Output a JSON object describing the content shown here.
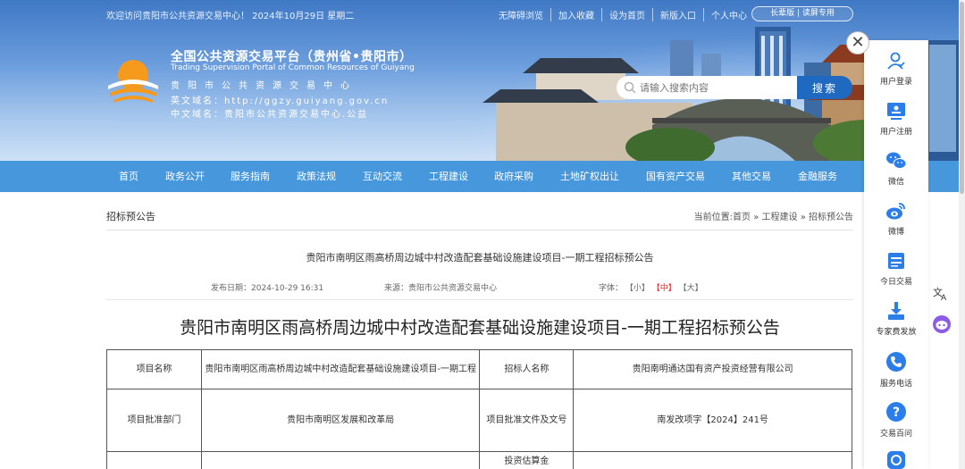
{
  "topbar": {
    "welcome": "欢迎访问贵阳市公共资源交易中心！  2024年10月29日 星期二",
    "links": [
      "无障碍浏览",
      "加入收藏",
      "设为首页",
      "新版入口",
      "个人中心"
    ],
    "pill": "长辈版  | 读屏专用"
  },
  "header": {
    "title_zh": "全国公共资源交易平台（贵州省•贵阳市）",
    "title_en": "Trading Supervision Portal of Common Resources of Guiyang",
    "subtitle": "贵阳市公共资源交易中心",
    "domain_en": "英文域名：http://ggzy.guiyang.gov.cn",
    "domain_zh": "中文域名：贵阳市公共资源交易中心.公益"
  },
  "search": {
    "placeholder": "请输入搜索内容",
    "button": "搜索"
  },
  "nav": [
    "首页",
    "政务公开",
    "服务指南",
    "政策法规",
    "互动交流",
    "工程建设",
    "政府采购",
    "土地矿权出让",
    "国有资产交易",
    "其他交易",
    "金融服务"
  ],
  "breadcrumb": {
    "section": "招标预公告",
    "path": "当前位置:首页 » 工程建设 » 招标预公告"
  },
  "article": {
    "heading": "贵阳市南明区雨高桥周边城中村改造配套基础设施建设项目-一期工程招标预公告",
    "publish_date": "发布日期：2024-10-29 16:31",
    "source": "来源：贵阳市公共资源交易中心",
    "font_label": "字体：",
    "font_small": "【小】",
    "font_medium": "【中】",
    "font_large": "【大】"
  },
  "document": {
    "title": "贵阳市南明区雨高桥周边城中村改造配套基础设施建设项目-一期工程招标预公告",
    "table": {
      "row1": [
        "项目名称",
        "贵阳市南明区雨高桥周边城中村改造配套基础设施建设项目-一期工程",
        "招标人名称",
        "贵阳南明通达国有资产投资经营有限公司"
      ],
      "row2": [
        "项目批准部门",
        "贵阳市南明区发展和改革局",
        "项目批准文件及文号",
        "南发改项字【2024】241号"
      ],
      "row3": [
        "",
        "",
        "投资估算金",
        ""
      ]
    }
  },
  "sidebar": [
    {
      "label": "用户登录",
      "icon": "user-login-icon"
    },
    {
      "label": "用户注册",
      "icon": "user-register-icon"
    },
    {
      "label": "微信",
      "icon": "wechat-icon"
    },
    {
      "label": "微博",
      "icon": "weibo-icon"
    },
    {
      "label": "今日交易",
      "icon": "today-trade-icon"
    },
    {
      "label": "专家费发放",
      "icon": "expert-fee-icon"
    },
    {
      "label": "服务电话",
      "icon": "phone-icon"
    },
    {
      "label": "交易百问",
      "icon": "faq-icon"
    }
  ],
  "colors": {
    "nav": "#4797dd",
    "accent": "#1f69c1",
    "red": "#e02020"
  }
}
